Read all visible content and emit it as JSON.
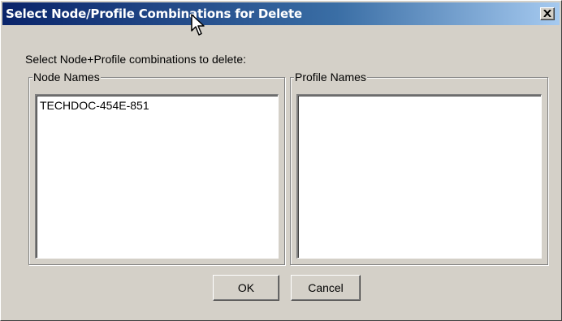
{
  "dialog": {
    "title": "Select Node/Profile Combinations for Delete",
    "close_icon": "close-icon",
    "prompt": "Select Node+Profile combinations to delete:"
  },
  "node_group": {
    "legend": "Node Names",
    "items": [
      "TECHDOC-454E-851"
    ]
  },
  "profile_group": {
    "legend": "Profile Names",
    "items": []
  },
  "buttons": {
    "ok_label": "OK",
    "cancel_label": "Cancel"
  },
  "colors": {
    "titlebar_start": "#0a246a",
    "titlebar_end": "#a6caf0",
    "dialog_face": "#d4d0c8"
  }
}
